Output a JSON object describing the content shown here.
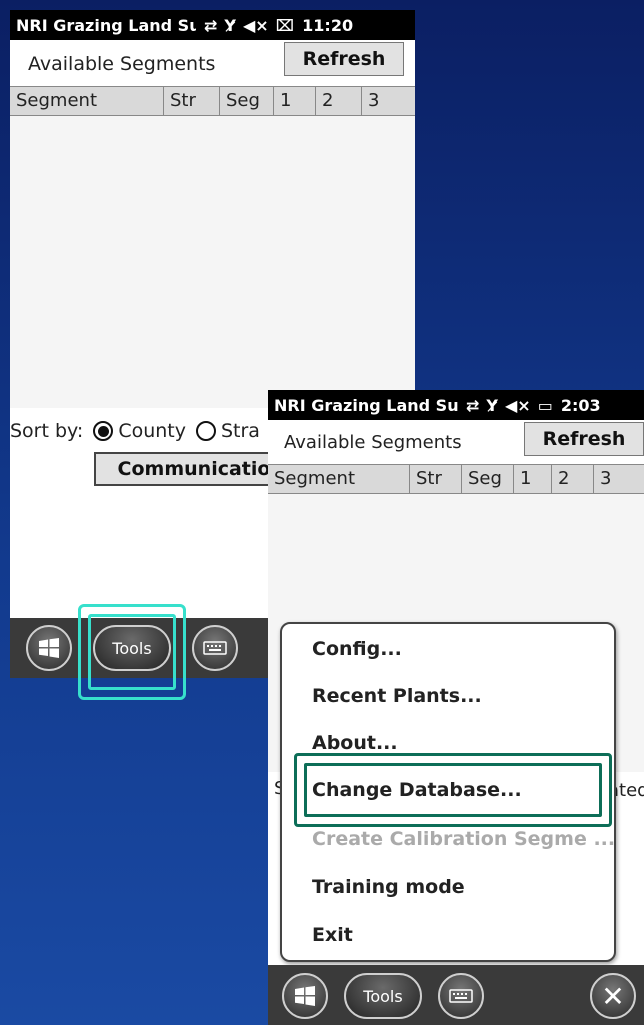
{
  "screen1": {
    "status": {
      "title": "NRI Grazing Land Sur",
      "time": "11:20",
      "battery_icon": "battery-charging-icon"
    },
    "available_label": "Available Segments",
    "refresh_label": "Refresh",
    "columns": [
      "Segment",
      "Str",
      "Seg",
      "1",
      "2",
      "3"
    ],
    "sort": {
      "label": "Sort by:",
      "option1": "County",
      "option2": "Stra"
    },
    "communication_label": "Communicatio",
    "taskbar": {
      "tools_label": "Tools"
    }
  },
  "screen2": {
    "status": {
      "title": "NRI Grazing Land Surv",
      "time": "2:03",
      "battery_icon": "battery-full-icon"
    },
    "available_label": "Available Segments",
    "refresh_label": "Refresh",
    "columns": [
      "Segment",
      "Str",
      "Seg",
      "1",
      "2",
      "3"
    ],
    "behind_left": "S",
    "behind_right": "ated",
    "menu": {
      "items": [
        {
          "label": "Config...",
          "enabled": true
        },
        {
          "label": "Recent Plants...",
          "enabled": true
        },
        {
          "label": "About...",
          "enabled": true
        },
        {
          "label": "Change Database...",
          "enabled": true
        },
        {
          "label": "Create Calibration Segme ...",
          "enabled": false
        },
        {
          "label": "Training mode",
          "enabled": true
        },
        {
          "label": "Exit",
          "enabled": true
        }
      ]
    },
    "taskbar": {
      "tools_label": "Tools"
    }
  },
  "colors": {
    "background": "#123a8e",
    "tools_highlight": "#37e0cc",
    "menu_highlight": "#0d6e58",
    "taskbar": "#3a3a3a"
  }
}
